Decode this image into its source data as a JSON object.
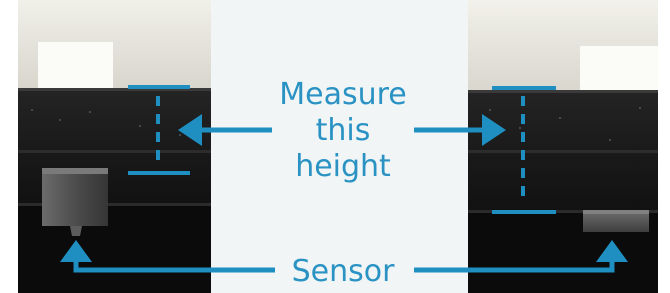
{
  "labels": {
    "measure_line1": "Measure",
    "measure_line2": "this",
    "measure_line3": "height",
    "sensor": "Sensor"
  },
  "colors": {
    "accent": "#1f8fc2",
    "center_panel": "#f1f5f6",
    "label_text": "#2a93c4"
  }
}
